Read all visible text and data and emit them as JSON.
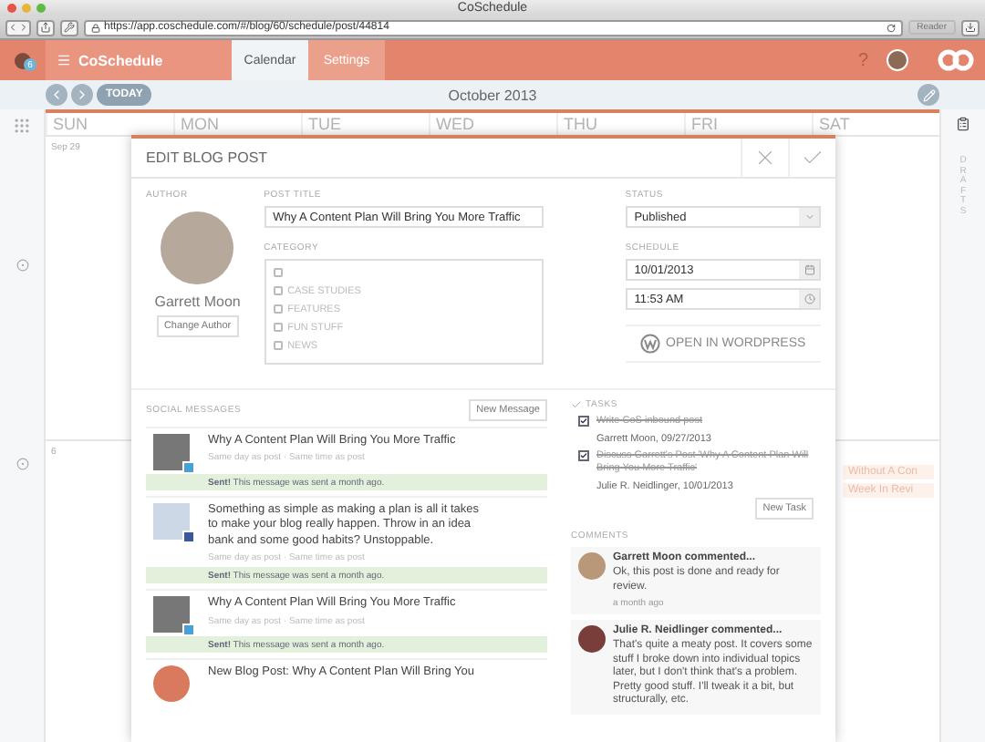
{
  "browser": {
    "title": "CoSchedule",
    "url": "https://app.coschedule.com/#/blog/60/schedule/post/44814",
    "reader": "Reader"
  },
  "app_header": {
    "notification_count": "6",
    "brand": "CoSchedule",
    "help": "?",
    "tabs": [
      {
        "label": "Calendar",
        "selected": true
      },
      {
        "label": "Settings",
        "selected": false
      }
    ]
  },
  "calendar": {
    "today": "TODAY",
    "month": "October 2013",
    "day_names": [
      "SUN",
      "MON",
      "TUE",
      "WED",
      "THU",
      "FRI",
      "SAT"
    ],
    "week_dates": [
      "Sep 29",
      "6"
    ],
    "events": [
      "Without A Con",
      "Week In Revi"
    ]
  },
  "sidebar": {
    "label": "DRAFTS"
  },
  "modal": {
    "title": "EDIT BLOG POST",
    "author": {
      "label": "AUTHOR",
      "name": "Garrett Moon",
      "button": "Change Author"
    },
    "post_title": {
      "label": "POST TITLE",
      "value": "Why A Content Plan Will Bring You More Traffic"
    },
    "category": {
      "label": "CATEGORY",
      "items": [
        {
          "checked": false
        },
        {
          "label": "CASE STUDIES",
          "checked": false
        },
        {
          "label": "FEATURES",
          "checked": false
        },
        {
          "label": "FUN STUFF",
          "checked": false
        },
        {
          "label": "NEWS",
          "checked": false
        }
      ]
    },
    "status": {
      "label": "STATUS",
      "value": "Published"
    },
    "schedule": {
      "label": "SCHEDULE",
      "date": "10/01/2013",
      "time": "11:53 AM"
    },
    "wordpress_button": "OPEN IN WORDPRESS",
    "social": {
      "label": "SOCIAL MESSAGES",
      "button": "New Message",
      "messages": [
        {
          "kind": "twitter",
          "text": "Why A Content Plan Will Bring You More Traffic",
          "timing": "Same day as post · Same time as post",
          "sent": "**Sent!** This message was sent a month ago."
        },
        {
          "kind": "facebook",
          "text": "Something as simple as making a plan is all it takes to make your blog really happen. Throw in an idea bank and some good habits? Unstoppable.",
          "timing": "Same day as post · Same time as post",
          "sent": "**Sent!** This message was sent a month ago."
        },
        {
          "kind": "twitter",
          "text": "Why A Content Plan Will Bring You More Traffic",
          "timing": "Same day as post · Same time as post",
          "sent": "**Sent!** This message was sent a month ago."
        },
        {
          "kind": "blog",
          "text": "New Blog Post: Why A Content Plan Will Bring You"
        }
      ]
    },
    "tasks": {
      "label": "TASKS",
      "button": "New Task",
      "items": [
        {
          "text": "Write CoS inbound post",
          "meta": "Garrett Moon, 09/27/2013",
          "checked": true
        },
        {
          "text": "Discuss Garrett's Post 'Why A Content Plan Will Bring You More Traffic'",
          "meta": "Julie R. Neidlinger, 10/01/2013",
          "checked": true
        }
      ]
    },
    "comments": {
      "label": "COMMENTS",
      "items": [
        {
          "author": "Garrett Moon commented...",
          "text": "Ok, this post is done and ready for review.",
          "time": "a month ago"
        },
        {
          "author": "Julie R. Neidlinger commented...",
          "text": "That's quite a meaty post. It covers some stuff I broke down into individual topics later, but I don't think that's a problem. Pretty good stuff. I'll tweak it a bit, but structurally, etc."
        }
      ]
    }
  }
}
